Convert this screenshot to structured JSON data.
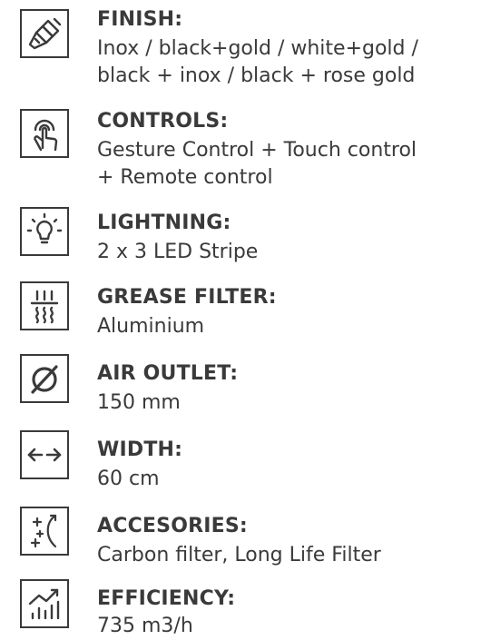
{
  "specs": [
    {
      "icon": "paintbrush-icon",
      "label": "FINISH:",
      "lines": [
        "Inox / black+gold / white+gold /",
        "black + inox / black + rose gold"
      ]
    },
    {
      "icon": "touch-hand-icon",
      "label": "CONTROLS:",
      "lines": [
        "Gesture Control + Touch control",
        "+ Remote control"
      ]
    },
    {
      "icon": "lightbulb-icon",
      "label": "LIGHTNING:",
      "lines": [
        "2 x 3 LED Stripe"
      ]
    },
    {
      "icon": "grease-filter-icon",
      "label": "GREASE FILTER:",
      "lines": [
        "Aluminium"
      ]
    },
    {
      "icon": "diameter-icon",
      "label": "AIR OUTLET:",
      "lines": [
        "150 mm"
      ]
    },
    {
      "icon": "width-arrows-icon",
      "label": "WIDTH:",
      "lines": [
        "60 cm"
      ]
    },
    {
      "icon": "sparkle-icon",
      "label": "ACCESORIES:",
      "lines": [
        "Carbon filter, Long Life Filter"
      ]
    },
    {
      "icon": "efficiency-chart-icon",
      "label": "EFFICIENCY:",
      "lines": [
        "735 m3/h"
      ]
    }
  ]
}
